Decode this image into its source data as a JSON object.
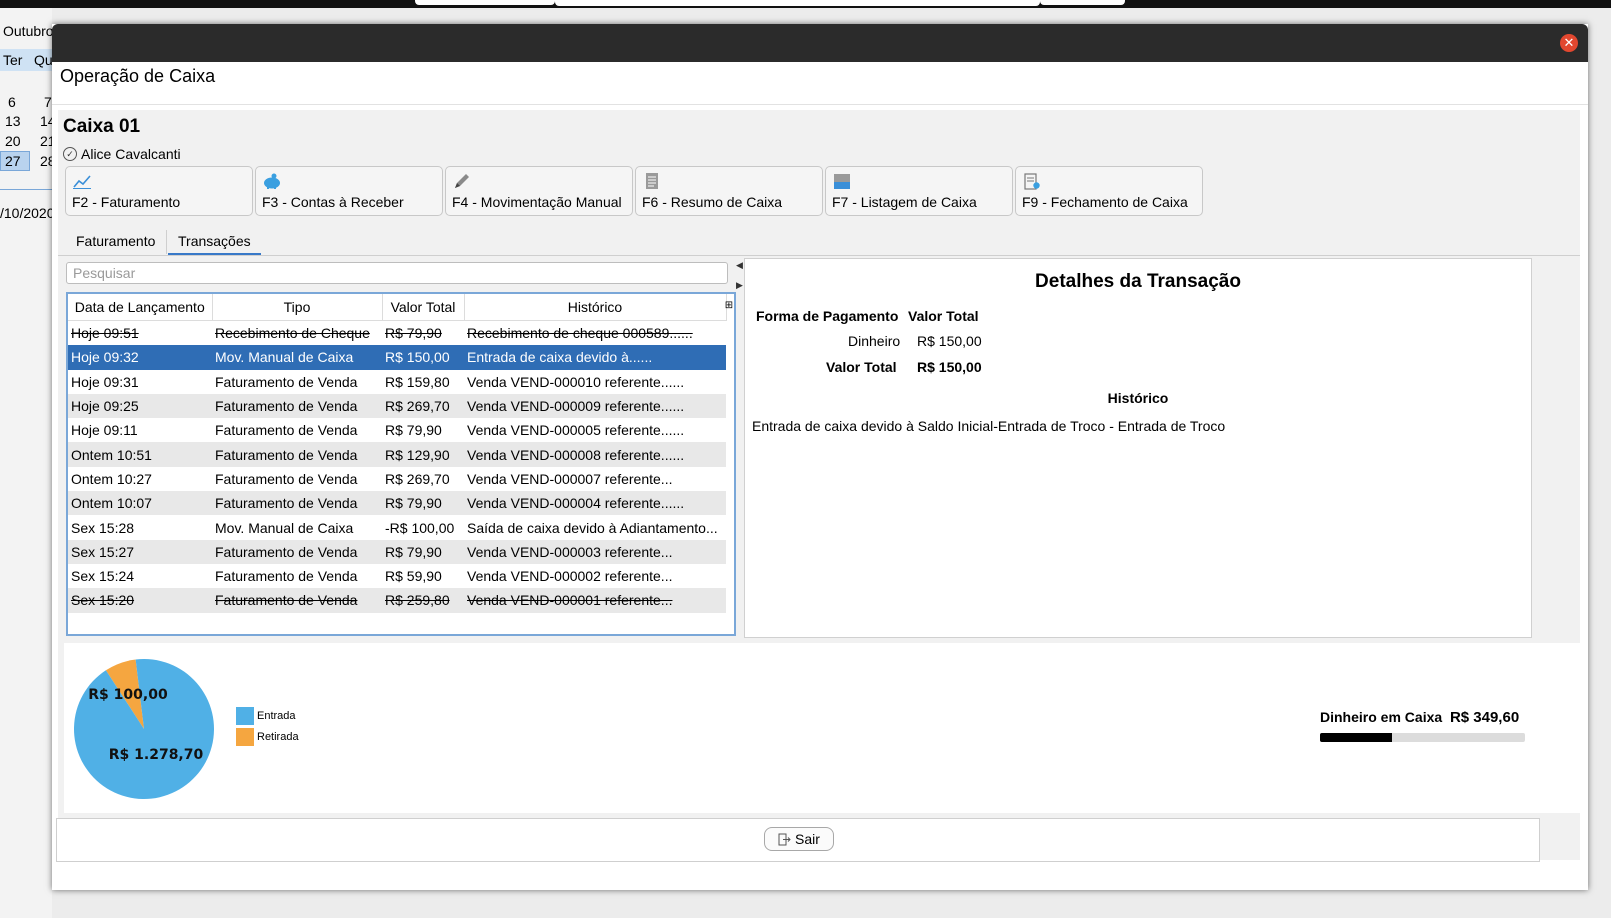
{
  "background_calendar": {
    "month": "Outubro",
    "weekday_headers": [
      "Ter",
      "Qu"
    ],
    "days": [
      "6",
      "7",
      "13",
      "14",
      "20",
      "21",
      "27",
      "28"
    ],
    "date_fragment": "/10/2020"
  },
  "window": {
    "title": "Operação de Caixa",
    "close_icon": "close-icon"
  },
  "caixa": {
    "name": "Caixa 01",
    "user": "Alice Cavalcanti"
  },
  "toolbar": [
    {
      "label": "F2 - Faturamento",
      "icon": "chart-line-icon"
    },
    {
      "label": "F3 - Contas à Receber",
      "icon": "piggy-bank-icon"
    },
    {
      "label": "F4 - Movimentação Manual",
      "icon": "pencil-icon"
    },
    {
      "label": "F6 - Resumo de Caixa",
      "icon": "document-icon"
    },
    {
      "label": "F7 - Listagem de Caixa",
      "icon": "folder-icon"
    },
    {
      "label": "F9 - Fechamento de Caixa",
      "icon": "clipboard-icon"
    }
  ],
  "tabs": [
    {
      "label": "Faturamento",
      "active": false
    },
    {
      "label": "Transações",
      "active": true
    }
  ],
  "search": {
    "placeholder": "Pesquisar",
    "value": ""
  },
  "table": {
    "headers": [
      "Data de Lançamento",
      "Tipo",
      "Valor Total",
      "Histórico"
    ],
    "rows": [
      {
        "date": "Hoje 09:51",
        "type": "Recebimento de Cheque",
        "value": "R$ 79,90",
        "history": "Recebimento de cheque 000589......",
        "cancelled": true,
        "selected": false
      },
      {
        "date": "Hoje 09:32",
        "type": "Mov. Manual de Caixa",
        "value": "R$ 150,00",
        "history": "Entrada de caixa devido à......",
        "cancelled": false,
        "selected": true
      },
      {
        "date": "Hoje 09:31",
        "type": "Faturamento de Venda",
        "value": "R$ 159,80",
        "history": "Venda VEND-000010 referente......",
        "cancelled": false,
        "selected": false
      },
      {
        "date": "Hoje 09:25",
        "type": "Faturamento de Venda",
        "value": "R$ 269,70",
        "history": "Venda VEND-000009 referente......",
        "cancelled": false,
        "selected": false
      },
      {
        "date": "Hoje 09:11",
        "type": "Faturamento de Venda",
        "value": "R$ 79,90",
        "history": "Venda VEND-000005 referente......",
        "cancelled": false,
        "selected": false
      },
      {
        "date": "Ontem 10:51",
        "type": "Faturamento de Venda",
        "value": "R$ 129,90",
        "history": "Venda VEND-000008 referente......",
        "cancelled": false,
        "selected": false
      },
      {
        "date": "Ontem 10:27",
        "type": "Faturamento de Venda",
        "value": "R$ 269,70",
        "history": "Venda VEND-000007 referente...",
        "cancelled": false,
        "selected": false
      },
      {
        "date": "Ontem 10:07",
        "type": "Faturamento de Venda",
        "value": "R$ 79,90",
        "history": "Venda VEND-000004 referente......",
        "cancelled": false,
        "selected": false
      },
      {
        "date": "Sex 15:28",
        "type": "Mov. Manual de Caixa",
        "value": "-R$ 100,00",
        "history": "Saída de caixa devido à Adiantamento...",
        "cancelled": false,
        "selected": false
      },
      {
        "date": "Sex 15:27",
        "type": "Faturamento de Venda",
        "value": "R$ 79,90",
        "history": "Venda VEND-000003 referente...",
        "cancelled": false,
        "selected": false
      },
      {
        "date": "Sex 15:24",
        "type": "Faturamento de Venda",
        "value": "R$ 59,90",
        "history": "Venda VEND-000002 referente...",
        "cancelled": false,
        "selected": false
      },
      {
        "date": "Sex 15:20",
        "type": "Faturamento de Venda",
        "value": "R$ 259,80",
        "history": "Venda VEND-000001 referente...",
        "cancelled": true,
        "selected": false
      }
    ]
  },
  "details": {
    "title": "Detalhes da Transação",
    "col_payment": "Forma de Pagamento",
    "col_total": "Valor Total",
    "payment_method": "Dinheiro",
    "payment_value": "R$ 150,00",
    "total_label": "Valor Total",
    "total_value": "R$ 150,00",
    "history_title": "Histórico",
    "history_text": "Entrada de caixa devido à Saldo Inicial-Entrada de Troco - Entrada de Troco"
  },
  "chart_data": {
    "type": "pie",
    "slices": [
      {
        "label": "Entrada",
        "value": 1278.7,
        "display": "R$ 1.278,70",
        "color": "#50b0e6"
      },
      {
        "label": "Retirada",
        "value": 100.0,
        "display": "R$ 100,00",
        "color": "#f5a640"
      }
    ],
    "legend_position": "right"
  },
  "cash": {
    "label": "Dinheiro em Caixa",
    "value": "R$ 349,60",
    "progress_fraction": 0.35
  },
  "footer": {
    "exit_label": "Sair",
    "exit_icon": "exit-icon"
  },
  "colors": {
    "selection": "#2f6db5",
    "titlebar": "#2b2b2b",
    "close": "#e2472f"
  }
}
